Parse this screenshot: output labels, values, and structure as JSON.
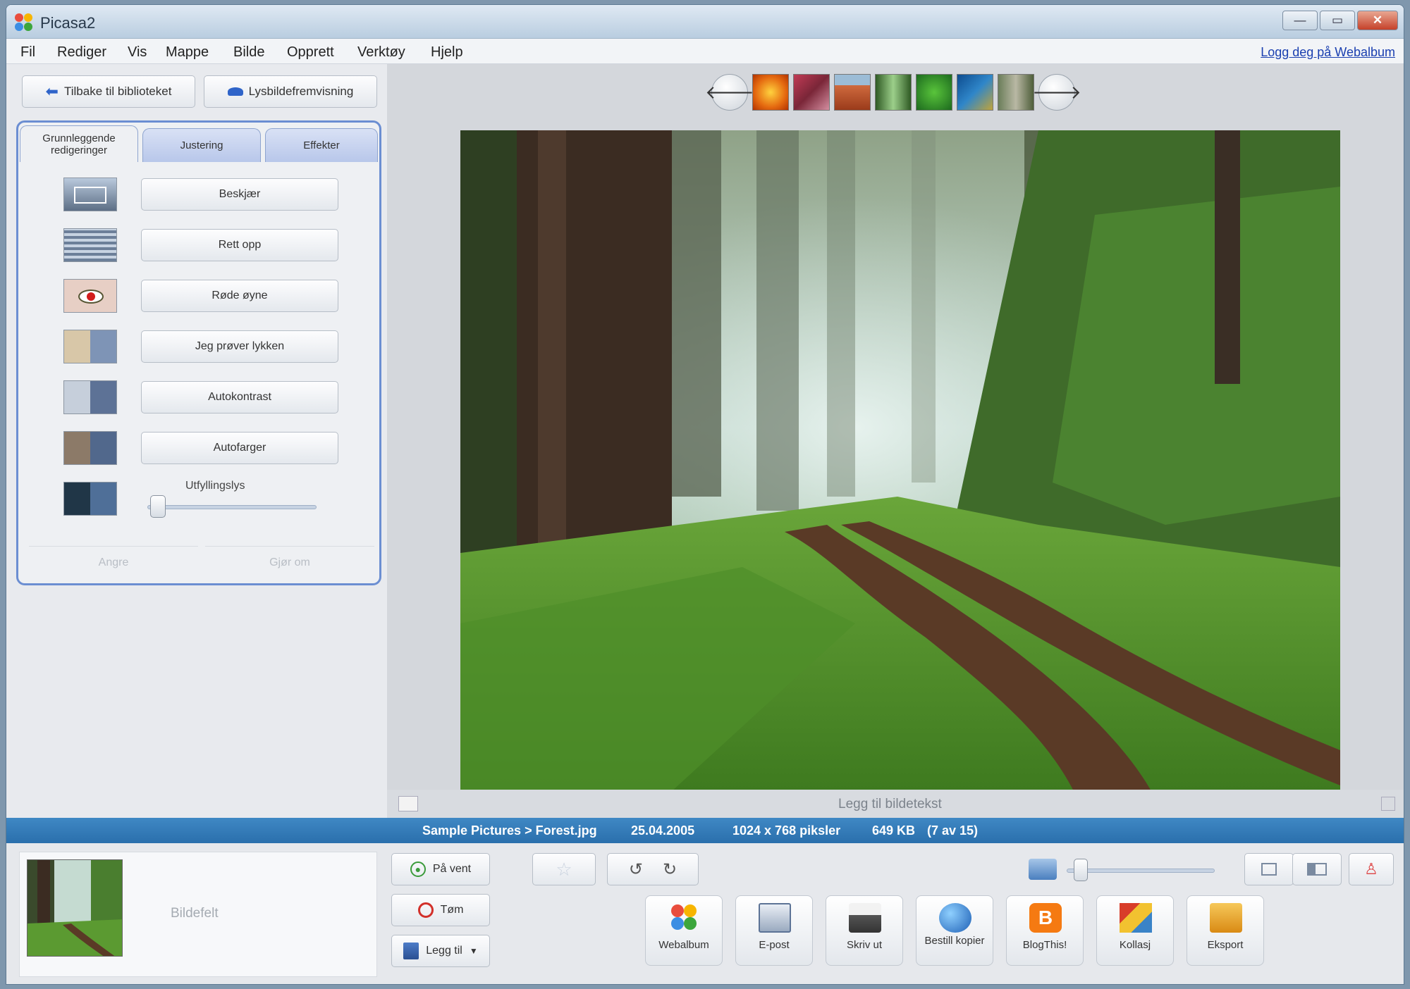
{
  "window": {
    "title": "Picasa2",
    "controls": {
      "minimize": "—",
      "maximize": "▭",
      "close": "✕"
    }
  },
  "menu": {
    "items": [
      "Fil",
      "Rediger",
      "Vis",
      "Mappe",
      "Bilde",
      "Opprett",
      "Verktøy",
      "Hjelp"
    ],
    "signin": "Logg deg på Webalbum"
  },
  "left_panel": {
    "back_button": "Tilbake til biblioteket",
    "slideshow_button": "Lysbildefremvisning",
    "tabs": [
      {
        "label": "Grunnleggende redigeringer",
        "active": true
      },
      {
        "label": "Justering",
        "active": false
      },
      {
        "label": "Effekter",
        "active": false
      }
    ],
    "tools": [
      {
        "label": "Beskjær",
        "icon": "crop-icon"
      },
      {
        "label": "Rett opp",
        "icon": "straighten-icon"
      },
      {
        "label": "Røde øyne",
        "icon": "red-eye-icon"
      },
      {
        "label": "Jeg prøver lykken",
        "icon": "lucky-icon"
      },
      {
        "label": "Autokontrast",
        "icon": "auto-contrast-icon"
      },
      {
        "label": "Autofarger",
        "icon": "auto-color-icon"
      }
    ],
    "fill_light": {
      "label": "Utfyllingslys",
      "value": 0
    },
    "undo_label": "Angre",
    "redo_label": "Gjør om"
  },
  "filmstrip": {
    "prev_icon": "arrow-left-icon",
    "next_icon": "arrow-right-icon",
    "thumb_count": 7
  },
  "photo": {
    "caption_placeholder": "Legg til bildetekst"
  },
  "status": {
    "path": "Sample Pictures > Forest.jpg",
    "date": "25.04.2005",
    "dimensions": "1024 x 768 piksler",
    "size": "649 KB",
    "position": "(7 av 15)"
  },
  "tray": {
    "label": "Bildefelt",
    "hold_button": "På vent",
    "clear_button": "Tøm",
    "add_button": "Legg til",
    "actions": [
      {
        "label": "Webalbum",
        "icon": "webalbum-icon"
      },
      {
        "label": "E-post",
        "icon": "email-icon"
      },
      {
        "label": "Skriv ut",
        "icon": "printer-icon"
      },
      {
        "label": "Bestill kopier",
        "icon": "globe-icon"
      },
      {
        "label": "BlogThis!",
        "icon": "blogger-icon"
      },
      {
        "label": "Kollasj",
        "icon": "collage-icon"
      },
      {
        "label": "Eksport",
        "icon": "export-icon"
      }
    ]
  },
  "colors": {
    "accent": "#2f77b5",
    "tab_border": "#6b8ed2",
    "link": "#1a3fb0"
  }
}
